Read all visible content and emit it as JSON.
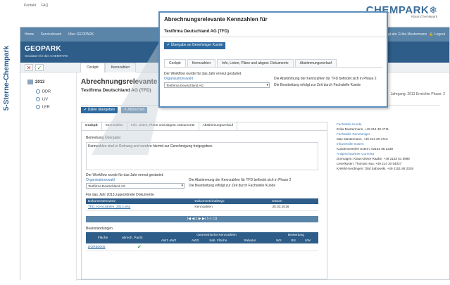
{
  "top_links": [
    "Kontakt",
    "FAQ"
  ],
  "brand": {
    "name": "CHEMPARK",
    "tagline": "Klaus-Chemiepark"
  },
  "side_label": "5-Sterne-Chempark",
  "nav": {
    "items": [
      "Home",
      "Serviceboard",
      "Über GEOPARK"
    ],
    "user": "Eingeloggt als: Erika Mustermann",
    "logout": "Logout"
  },
  "app": {
    "title": "GEOPARK",
    "subtitle": "Geodaten für den CHEMPARK"
  },
  "main_tabs": [
    "Cockpit",
    "Kennzahlen"
  ],
  "sidebar": {
    "year": "2013",
    "items": [
      "DDR",
      "LiV",
      "LER"
    ]
  },
  "page": {
    "title": "Abrechnungsrelevante Kennzahlen für",
    "company": "Testfirma Deutschland AG (TFD)",
    "right_info": "Jahrgang: 2013 Erreichte Phase: 2"
  },
  "actions": {
    "submit": "Daten übergeben",
    "cancel": "Abbrechen"
  },
  "panel_tabs": [
    "Cockpit",
    "Kennzahlen",
    "Info, Listen, Pläne und abgest. Dokumente",
    "Abstimmungsverlauf"
  ],
  "remark": {
    "label": "Bemerkung Übergabe:",
    "text": "Kennzahlen sind in Ordnung und werden hiermit zur Genehmigung freigegeben."
  },
  "workflow": {
    "restart_text": "Der Workflow wurde für das Jahr erneut gestartet.",
    "org_label": "Organisationswahl",
    "org_value": "Testfirma Deutschland AG",
    "status_line1": "Die Abstimmung der Kennzahlen für TFD befindet sich in Phase 2",
    "status_line2": "Die Bearbeitung erfolgt zur Zeit durch Fachstelle Kunde"
  },
  "docs": {
    "caption": "Für das Jahr 2013 zugeordnete Dokumente",
    "headers": [
      "Dokumentenname",
      "Dokumentinhaltstyp",
      "Datum"
    ],
    "rows": [
      [
        "TFD_Kennzahlen_2013.xlsx",
        "Kennzahlen",
        "30.03.2016"
      ]
    ],
    "pager": "|◀ ◀ 1 ▶ ▶| 1-1 (1)"
  },
  "objections": {
    "caption": "Beanstandungen",
    "headers": [
      "Fläche",
      "abrech. Pacht",
      "AW1 AW2",
      "AW3",
      "bab. Fläche",
      "Rabatur",
      "WS",
      "BS",
      "UW"
    ],
    "group_geo": "Geometrische Kennzahlen",
    "group_eval": "Bewertung",
    "rows": [
      [
        "DORB0005",
        "✔"
      ]
    ]
  },
  "contacts": [
    {
      "h": "Fachstelle Kunde",
      "v": "Erika Mustermann, +49 214 30 4711"
    },
    {
      "h": "Fachstelle Genehmiger",
      "v": "Max Mustermann, +49 214 30 4712"
    },
    {
      "h": "Infoverteiler Extern",
      "v": "Kundenverteiler Extern, 02151 88 2338"
    },
    {
      "h": "Ansprechpartner Currenta",
      "v": "Dormagen: Klaus-Dieter Raabe, +49 2133 51 5996"
    },
    {
      "h": "",
      "v": "Leverkusen: Thomas Hau, +49 214 30 54027"
    },
    {
      "h": "",
      "v": "Krefeld-Uerdingen: Olaf Sabowski, +49 2151 88 2338"
    }
  ],
  "zoom": {
    "title": "Abrechnungsrelevante Kennzahlen für",
    "company": "Testfirma Deutschland AG (TFD)",
    "action": "Übergabe an Genehmiger Kunde",
    "tabs": [
      "Cockpit",
      "Kennzahlen",
      "Info, Listen, Pläne und abgest. Dokumente",
      "Abstimmungsverlauf"
    ],
    "restart_text": "Der Workflow wurde für das Jahr erneut gestartet.",
    "org_label": "Organisationswahl",
    "org_value": "Testfirma Deutschland AG",
    "status_line1": "Die Abstimmung der Kennzahlen für TFD befindet sich in Phase 2",
    "status_line2": "Die Bearbeitung erfolgt zur Zeit durch Fachstelle Kunde"
  }
}
